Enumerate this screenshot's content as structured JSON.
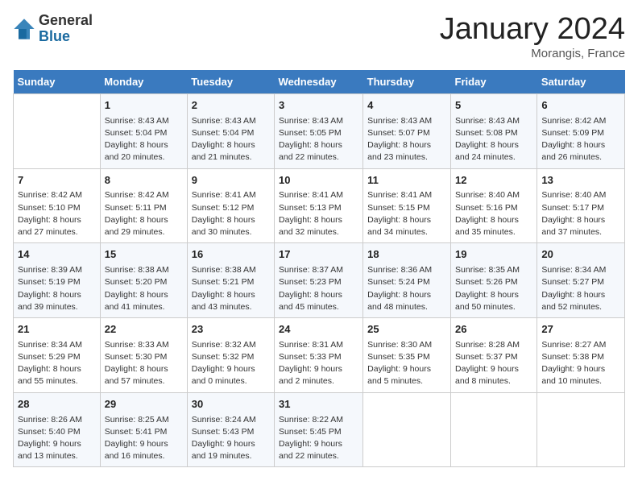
{
  "header": {
    "logo_general": "General",
    "logo_blue": "Blue",
    "month_title": "January 2024",
    "location": "Morangis, France"
  },
  "columns": [
    "Sunday",
    "Monday",
    "Tuesday",
    "Wednesday",
    "Thursday",
    "Friday",
    "Saturday"
  ],
  "weeks": [
    [
      {
        "day": "",
        "sunrise": "",
        "sunset": "",
        "daylight": ""
      },
      {
        "day": "1",
        "sunrise": "Sunrise: 8:43 AM",
        "sunset": "Sunset: 5:04 PM",
        "daylight": "Daylight: 8 hours and 20 minutes."
      },
      {
        "day": "2",
        "sunrise": "Sunrise: 8:43 AM",
        "sunset": "Sunset: 5:04 PM",
        "daylight": "Daylight: 8 hours and 21 minutes."
      },
      {
        "day": "3",
        "sunrise": "Sunrise: 8:43 AM",
        "sunset": "Sunset: 5:05 PM",
        "daylight": "Daylight: 8 hours and 22 minutes."
      },
      {
        "day": "4",
        "sunrise": "Sunrise: 8:43 AM",
        "sunset": "Sunset: 5:07 PM",
        "daylight": "Daylight: 8 hours and 23 minutes."
      },
      {
        "day": "5",
        "sunrise": "Sunrise: 8:43 AM",
        "sunset": "Sunset: 5:08 PM",
        "daylight": "Daylight: 8 hours and 24 minutes."
      },
      {
        "day": "6",
        "sunrise": "Sunrise: 8:42 AM",
        "sunset": "Sunset: 5:09 PM",
        "daylight": "Daylight: 8 hours and 26 minutes."
      }
    ],
    [
      {
        "day": "7",
        "sunrise": "Sunrise: 8:42 AM",
        "sunset": "Sunset: 5:10 PM",
        "daylight": "Daylight: 8 hours and 27 minutes."
      },
      {
        "day": "8",
        "sunrise": "Sunrise: 8:42 AM",
        "sunset": "Sunset: 5:11 PM",
        "daylight": "Daylight: 8 hours and 29 minutes."
      },
      {
        "day": "9",
        "sunrise": "Sunrise: 8:41 AM",
        "sunset": "Sunset: 5:12 PM",
        "daylight": "Daylight: 8 hours and 30 minutes."
      },
      {
        "day": "10",
        "sunrise": "Sunrise: 8:41 AM",
        "sunset": "Sunset: 5:13 PM",
        "daylight": "Daylight: 8 hours and 32 minutes."
      },
      {
        "day": "11",
        "sunrise": "Sunrise: 8:41 AM",
        "sunset": "Sunset: 5:15 PM",
        "daylight": "Daylight: 8 hours and 34 minutes."
      },
      {
        "day": "12",
        "sunrise": "Sunrise: 8:40 AM",
        "sunset": "Sunset: 5:16 PM",
        "daylight": "Daylight: 8 hours and 35 minutes."
      },
      {
        "day": "13",
        "sunrise": "Sunrise: 8:40 AM",
        "sunset": "Sunset: 5:17 PM",
        "daylight": "Daylight: 8 hours and 37 minutes."
      }
    ],
    [
      {
        "day": "14",
        "sunrise": "Sunrise: 8:39 AM",
        "sunset": "Sunset: 5:19 PM",
        "daylight": "Daylight: 8 hours and 39 minutes."
      },
      {
        "day": "15",
        "sunrise": "Sunrise: 8:38 AM",
        "sunset": "Sunset: 5:20 PM",
        "daylight": "Daylight: 8 hours and 41 minutes."
      },
      {
        "day": "16",
        "sunrise": "Sunrise: 8:38 AM",
        "sunset": "Sunset: 5:21 PM",
        "daylight": "Daylight: 8 hours and 43 minutes."
      },
      {
        "day": "17",
        "sunrise": "Sunrise: 8:37 AM",
        "sunset": "Sunset: 5:23 PM",
        "daylight": "Daylight: 8 hours and 45 minutes."
      },
      {
        "day": "18",
        "sunrise": "Sunrise: 8:36 AM",
        "sunset": "Sunset: 5:24 PM",
        "daylight": "Daylight: 8 hours and 48 minutes."
      },
      {
        "day": "19",
        "sunrise": "Sunrise: 8:35 AM",
        "sunset": "Sunset: 5:26 PM",
        "daylight": "Daylight: 8 hours and 50 minutes."
      },
      {
        "day": "20",
        "sunrise": "Sunrise: 8:34 AM",
        "sunset": "Sunset: 5:27 PM",
        "daylight": "Daylight: 8 hours and 52 minutes."
      }
    ],
    [
      {
        "day": "21",
        "sunrise": "Sunrise: 8:34 AM",
        "sunset": "Sunset: 5:29 PM",
        "daylight": "Daylight: 8 hours and 55 minutes."
      },
      {
        "day": "22",
        "sunrise": "Sunrise: 8:33 AM",
        "sunset": "Sunset: 5:30 PM",
        "daylight": "Daylight: 8 hours and 57 minutes."
      },
      {
        "day": "23",
        "sunrise": "Sunrise: 8:32 AM",
        "sunset": "Sunset: 5:32 PM",
        "daylight": "Daylight: 9 hours and 0 minutes."
      },
      {
        "day": "24",
        "sunrise": "Sunrise: 8:31 AM",
        "sunset": "Sunset: 5:33 PM",
        "daylight": "Daylight: 9 hours and 2 minutes."
      },
      {
        "day": "25",
        "sunrise": "Sunrise: 8:30 AM",
        "sunset": "Sunset: 5:35 PM",
        "daylight": "Daylight: 9 hours and 5 minutes."
      },
      {
        "day": "26",
        "sunrise": "Sunrise: 8:28 AM",
        "sunset": "Sunset: 5:37 PM",
        "daylight": "Daylight: 9 hours and 8 minutes."
      },
      {
        "day": "27",
        "sunrise": "Sunrise: 8:27 AM",
        "sunset": "Sunset: 5:38 PM",
        "daylight": "Daylight: 9 hours and 10 minutes."
      }
    ],
    [
      {
        "day": "28",
        "sunrise": "Sunrise: 8:26 AM",
        "sunset": "Sunset: 5:40 PM",
        "daylight": "Daylight: 9 hours and 13 minutes."
      },
      {
        "day": "29",
        "sunrise": "Sunrise: 8:25 AM",
        "sunset": "Sunset: 5:41 PM",
        "daylight": "Daylight: 9 hours and 16 minutes."
      },
      {
        "day": "30",
        "sunrise": "Sunrise: 8:24 AM",
        "sunset": "Sunset: 5:43 PM",
        "daylight": "Daylight: 9 hours and 19 minutes."
      },
      {
        "day": "31",
        "sunrise": "Sunrise: 8:22 AM",
        "sunset": "Sunset: 5:45 PM",
        "daylight": "Daylight: 9 hours and 22 minutes."
      },
      {
        "day": "",
        "sunrise": "",
        "sunset": "",
        "daylight": ""
      },
      {
        "day": "",
        "sunrise": "",
        "sunset": "",
        "daylight": ""
      },
      {
        "day": "",
        "sunrise": "",
        "sunset": "",
        "daylight": ""
      }
    ]
  ]
}
